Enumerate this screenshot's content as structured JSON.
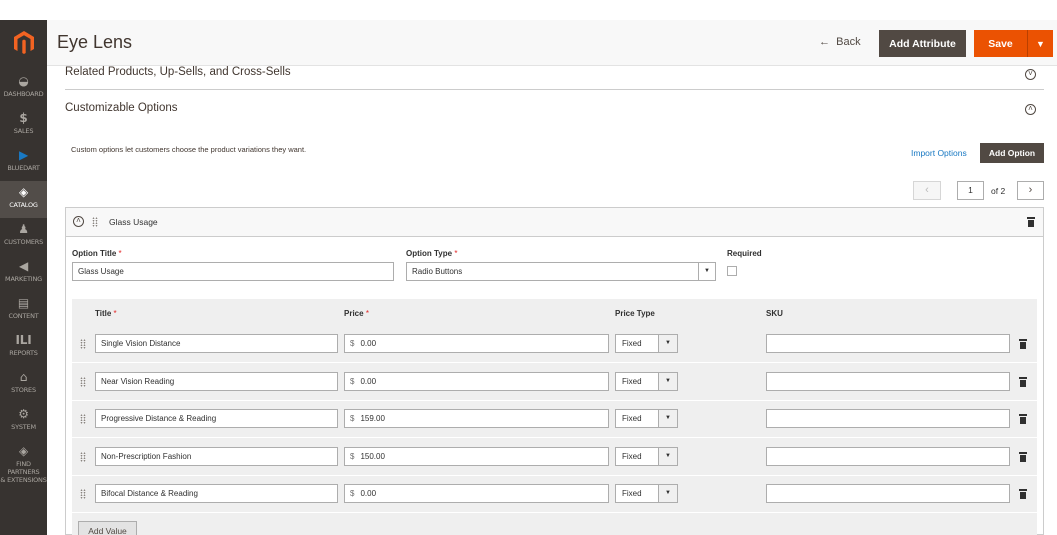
{
  "sidebar": {
    "items": [
      {
        "label": "DASHBOARD",
        "icon": "dashboard-icon"
      },
      {
        "label": "SALES",
        "icon": "dollar-icon"
      },
      {
        "label": "BLUEDART",
        "icon": "play-icon"
      },
      {
        "label": "CATALOG",
        "icon": "cube-icon"
      },
      {
        "label": "CUSTOMERS",
        "icon": "person-icon"
      },
      {
        "label": "MARKETING",
        "icon": "megaphone-icon"
      },
      {
        "label": "CONTENT",
        "icon": "content-icon"
      },
      {
        "label": "REPORTS",
        "icon": "bar-chart-icon"
      },
      {
        "label": "STORES",
        "icon": "store-icon"
      },
      {
        "label": "SYSTEM",
        "icon": "gear-icon"
      },
      {
        "label": "FIND PARTNERS",
        "label2": "& EXTENSIONS",
        "icon": "box-icon"
      }
    ],
    "active": "CATALOG"
  },
  "header": {
    "title": "Eye Lens",
    "back_label": "Back",
    "add_attribute_label": "Add Attribute",
    "save_label": "Save"
  },
  "sections": {
    "related": "Related Products, Up-Sells, and Cross-Sells",
    "custom": "Customizable Options"
  },
  "custom_options": {
    "description": "Custom options let customers choose the product variations they want.",
    "import_label": "Import Options",
    "add_option_label": "Add Option",
    "pager": {
      "page": "1",
      "of": "of 2"
    },
    "option": {
      "name": "Glass Usage",
      "title_label": "Option Title",
      "title_value": "Glass Usage",
      "type_label": "Option Type",
      "type_value": "Radio Buttons",
      "required_label": "Required"
    },
    "columns": {
      "title": "Title",
      "price": "Price",
      "price_type": "Price Type",
      "sku": "SKU"
    },
    "price_symbol": "$",
    "rows": [
      {
        "title": "Single Vision Distance",
        "price": "0.00",
        "price_type": "Fixed",
        "sku": ""
      },
      {
        "title": "Near Vision Reading",
        "price": "0.00",
        "price_type": "Fixed",
        "sku": ""
      },
      {
        "title": "Progressive Distance & Reading",
        "price": "159.00",
        "price_type": "Fixed",
        "sku": ""
      },
      {
        "title": "Non-Prescription Fashion",
        "price": "150.00",
        "price_type": "Fixed",
        "sku": ""
      },
      {
        "title": "Bifocal Distance & Reading",
        "price": "0.00",
        "price_type": "Fixed",
        "sku": ""
      }
    ],
    "add_value_label": "Add Value"
  },
  "colors": {
    "accent": "#eb5202",
    "dark_button": "#514943",
    "sidebar": "#373330",
    "link": "#1979c3"
  }
}
